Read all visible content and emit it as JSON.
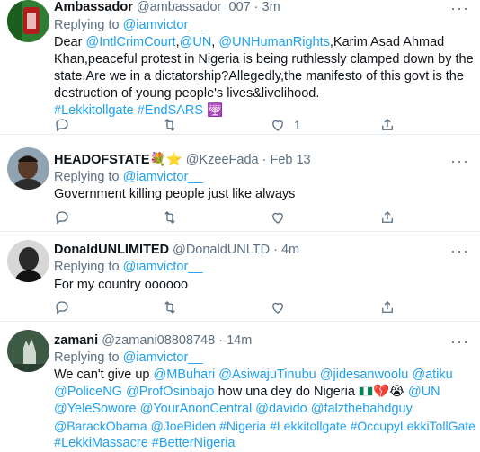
{
  "tweets": [
    {
      "name": "Ambassador",
      "handle": "@ambassador_007",
      "time": "3m",
      "replying_prefix": "Replying to",
      "replying_to": "@iamvictor__",
      "avatar_colors": [
        "#2e7d32",
        "#b71c1c"
      ],
      "body": {
        "line1_text_a": "Dear ",
        "line1_link_a": "@IntlCrimCourt",
        "line1_sep_a": ",",
        "line1_link_b": "@UN",
        "line1_sep_b": ", ",
        "line1_link_c": "@UNHumanRights",
        "line1_text_b": ",Karim Asad Ahmad",
        "line2": "Khan,peaceful protest in Nigeria is being ruthlessly clamped down by the",
        "line3": "state.Are we in a dictatorship?Allegedly,the manifesto of this govt is the",
        "line4": "destruction of young people's lives&livelihood.",
        "hashtag1": "#Lekkitollgate",
        "hashtag2": "#EndSARS",
        "emoji": "🕎"
      },
      "actions": {
        "reply_count": "",
        "retweet_count": "",
        "like_count": "1"
      }
    },
    {
      "name": "HEADOFSTATE",
      "name_emojis": "💐⭐",
      "handle": "@KzeeFada",
      "time": "Feb 13",
      "replying_prefix": "Replying to",
      "replying_to": "@iamvictor__",
      "body_text": "Government killing people just like always"
    },
    {
      "name": "DonaldUNLIMITED",
      "handle": "@DonaldUNLTD",
      "time": "4m",
      "replying_prefix": "Replying to",
      "replying_to": "@iamvictor__",
      "body_text": "For my country oooooo"
    },
    {
      "name": "zamani",
      "handle": "@zamani08808748",
      "time": "14m",
      "replying_prefix": "Replying to",
      "replying_to": "@iamvictor__",
      "body": {
        "line1_text": "We can't give up ",
        "line1_links": [
          "@MBuhari",
          "@AsiwajuTinubu",
          "@jidesanwoolu",
          "@atiku"
        ],
        "line2_link_a": "@PoliceNG",
        "line2_link_b": "@ProfOsinbajo",
        "line2_text": " how una  dey do Nigeria ",
        "line2_emojis": "💔😭",
        "line2_link_c": "@UN",
        "line3_links": [
          "@YeleSowore",
          "@YourAnonCentral",
          "@davido",
          "@falzthebahdguy"
        ],
        "line4_links": [
          "@BarackObama",
          "@JoeBiden",
          "#Nigeria",
          "#Lekkitollgate",
          "#OccupyLekkiTollGate"
        ],
        "line5_links": [
          "#LekkiMassacre",
          "#BetterNigeria"
        ]
      }
    }
  ],
  "icons": {
    "reply": "reply-icon",
    "retweet": "retweet-icon",
    "like": "like-icon",
    "share": "share-icon",
    "more": "more-icon"
  },
  "colors": {
    "link": "#1da1f2",
    "secondary": "#5b7083",
    "text": "#0f1419",
    "border": "#e6ecf0"
  },
  "more_glyph": "···",
  "dot": " · "
}
